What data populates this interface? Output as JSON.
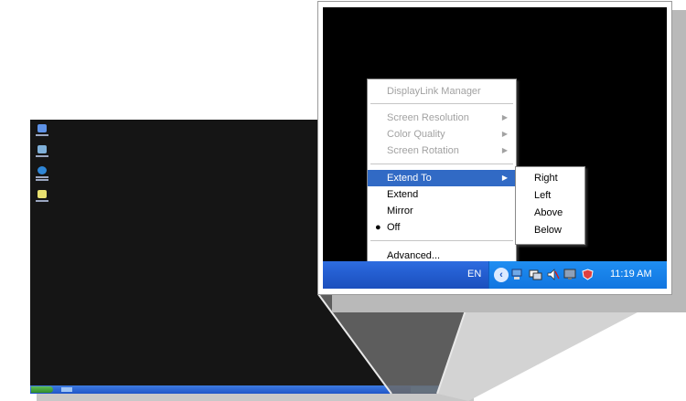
{
  "context_menu": {
    "title": "DisplayLink Manager",
    "settings": [
      {
        "label": "Screen Resolution",
        "disabled": true
      },
      {
        "label": "Color Quality",
        "disabled": true
      },
      {
        "label": "Screen Rotation",
        "disabled": true
      }
    ],
    "modes": [
      {
        "label": "Extend To",
        "selected": true
      },
      {
        "label": "Extend"
      },
      {
        "label": "Mirror"
      },
      {
        "label": "Off",
        "checked": true
      }
    ],
    "advanced": "Advanced..."
  },
  "submenu": {
    "items": [
      "Right",
      "Left",
      "Above",
      "Below"
    ]
  },
  "taskbar": {
    "language": "EN",
    "clock": "11:19 AM",
    "tray_icons": [
      "show-hidden-icon",
      "network-icon",
      "displaylink-icon",
      "volume-icon",
      "monitor-icon",
      "security-icon"
    ]
  },
  "small_desktop": {
    "icons": [
      "my-computer-icon",
      "documents-icon",
      "internet-explorer-icon",
      "recycle-bin-icon"
    ]
  },
  "colors": {
    "taskbar_blue": "#255fd2",
    "tray_blue": "#1f8ef2",
    "menu_highlight": "#316ac5",
    "start_green": "#3a9a33"
  }
}
